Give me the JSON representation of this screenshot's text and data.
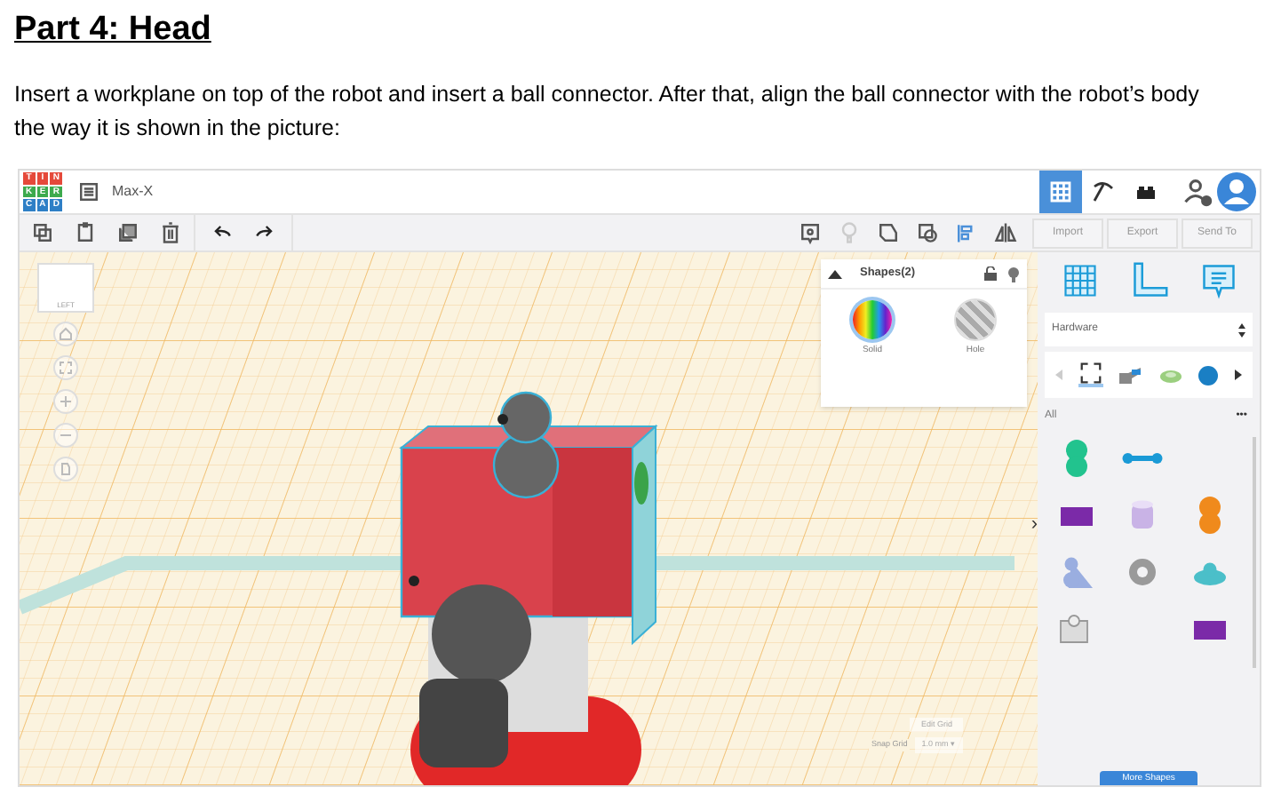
{
  "heading": "Part 4: Head",
  "instruction": "Insert a workplane on top of the robot and insert a ball connector. After that, align the ball connector with the robot’s body the way it is shown in the picture:",
  "app": {
    "logo": [
      "T",
      "I",
      "N",
      "K",
      "E",
      "R",
      "C",
      "A",
      "D"
    ],
    "project_name": "Max-X",
    "view_buttons": [
      {
        "kind": "grid",
        "selected": true
      },
      {
        "kind": "pickaxe",
        "selected": false
      },
      {
        "kind": "bricks",
        "selected": false
      }
    ],
    "actions": [
      "Import",
      "Export",
      "Send To"
    ],
    "view_cube_label": "LEFT",
    "inspector": {
      "title": "Shapes(2)",
      "options": [
        {
          "kind": "solid",
          "label": "Solid",
          "selected": true
        },
        {
          "kind": "hole",
          "label": "Hole",
          "selected": false
        }
      ]
    },
    "category": "Hardware",
    "filter": "All",
    "more_label": "•••",
    "collapse_arrow": "›",
    "shapes": [
      {
        "kind": "balls",
        "color": "#22c38e"
      },
      {
        "kind": "rod",
        "color": "#1a9ad6"
      },
      {
        "kind": "empty"
      },
      {
        "kind": "block",
        "color": "#7b2aa8"
      },
      {
        "kind": "cup",
        "color": "#c9b3e6"
      },
      {
        "kind": "balls",
        "color": "#f08a1c"
      },
      {
        "kind": "stand",
        "color": "#9aaee0"
      },
      {
        "kind": "gear",
        "color": "#9a9a9a"
      },
      {
        "kind": "disc",
        "color": "#4bbfc9"
      },
      {
        "kind": "clip",
        "color": "#dcdcdc"
      },
      {
        "kind": "empty"
      },
      {
        "kind": "block",
        "color": "#7b2aa8"
      }
    ],
    "edit_grid": "Edit Grid",
    "snap_grid_label": "Snap Grid",
    "snap_grid_value": "1.0 mm ▾",
    "more_shapes": "More Shapes"
  }
}
